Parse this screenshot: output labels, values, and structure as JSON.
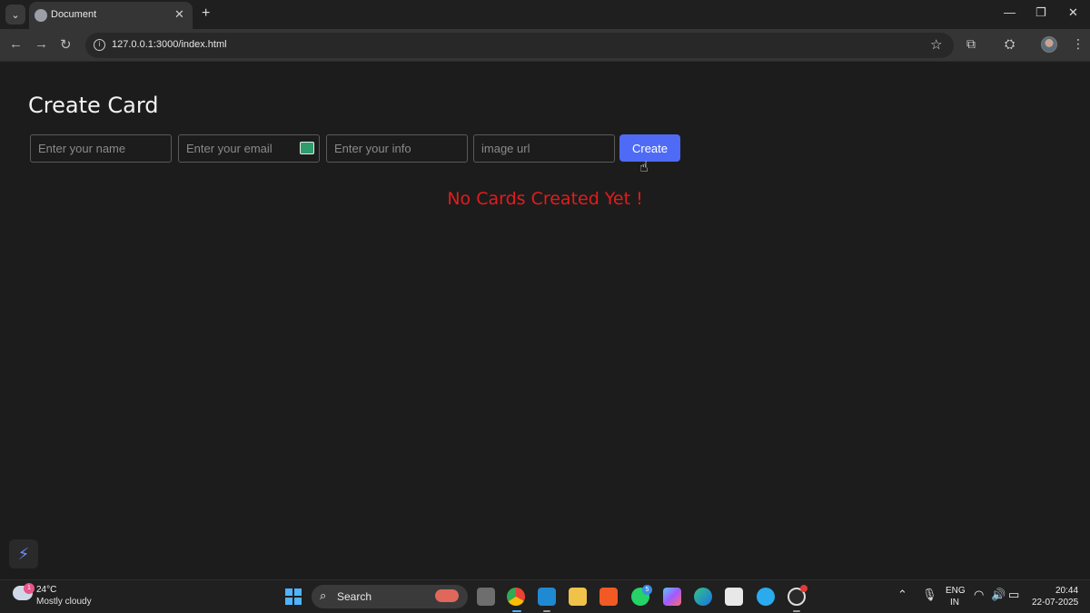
{
  "browser": {
    "tab_title": "Document",
    "url": "127.0.0.1:3000/index.html"
  },
  "page": {
    "heading": "Create Card",
    "inputs": {
      "name_placeholder": "Enter your name",
      "email_placeholder": "Enter your email",
      "info_placeholder": "Enter your info",
      "image_placeholder": "image url"
    },
    "create_label": "Create",
    "empty_message": "No Cards Created Yet !"
  },
  "taskbar": {
    "temperature": "24°C",
    "weather": "Mostly cloudy",
    "weather_badge": "1",
    "search_label": "Search",
    "whatsapp_badge": "5",
    "lang_line1": "ENG",
    "lang_line2": "IN",
    "time": "20:44",
    "date": "22-07-2025"
  },
  "colors": {
    "page_bg": "#1c1c1c",
    "create_button": "#4f6bf5",
    "empty_message": "#e51b1b"
  }
}
